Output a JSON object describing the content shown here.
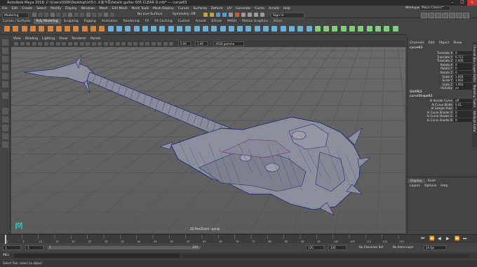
{
  "window": {
    "title": "Autodesk Maya 2018: C:\\Users\\SSW\\Desktop\\브라스 소울가족\\fatalis guitar 005 CLEAR D.mb*  ---  curve63"
  },
  "menubar": [
    "File",
    "Edit",
    "Create",
    "Select",
    "Modify",
    "Display",
    "Windows",
    "Mesh",
    "Edit Mesh",
    "Mesh Tools",
    "Mesh Display",
    "Curves",
    "Surfaces",
    "Deform",
    "UV",
    "Generate",
    "Cache",
    "Arnold",
    "Help"
  ],
  "workspace": {
    "label": "Workspace :",
    "value": "Maya Classic*"
  },
  "status": {
    "mode": "Modeling",
    "live_surface": "No Live Surface",
    "symmetry": "Symmetry: Off",
    "signin": "Sign In"
  },
  "shelf_tabs": [
    "Curves / Surfaces",
    "Poly Modeling",
    "Sculpting",
    "Rigging",
    "Animation",
    "Rendering",
    "FX",
    "FX Caching",
    "Custom",
    "Arnold",
    "Bifrost",
    "MASH",
    "Motion Graphics",
    "XGen"
  ],
  "shelf_active": "Poly Modeling",
  "panel_menu": [
    "View",
    "Shading",
    "Lighting",
    "Show",
    "Renderer",
    "Panels"
  ],
  "panel_toolbar": {
    "exposure": "0.00",
    "gamma": "1.00",
    "colorspace": "sRGB gamma"
  },
  "viewport": {
    "camera_label": "2D Pan/Zoom : persp",
    "axis_label": "y x z"
  },
  "channel_box": {
    "menu": [
      "Channels",
      "Edit",
      "Object",
      "Show"
    ],
    "object": "curve63",
    "attributes": [
      {
        "label": "Translate X",
        "value": "0"
      },
      {
        "label": "Translate Y",
        "value": "0.711"
      },
      {
        "label": "Translate Z",
        "value": "0.005"
      },
      {
        "label": "Rotate X",
        "value": "0"
      },
      {
        "label": "Rotate Y",
        "value": "0"
      },
      {
        "label": "Rotate Z",
        "value": "0"
      },
      {
        "label": "Scale X",
        "value": "1.003"
      },
      {
        "label": "Scale Y",
        "value": "1.003"
      },
      {
        "label": "Scale Z",
        "value": "1.003"
      },
      {
        "label": "Visibility",
        "value": "on"
      }
    ],
    "shapes_header": "SHAPES",
    "shape_name": "curveShape63",
    "shape_attributes": [
      {
        "label": "Ai Render Curve",
        "value": "off"
      },
      {
        "label": "Ai Curve Width",
        "value": "0.01"
      },
      {
        "label": "Ai Sample Rate",
        "value": "5"
      },
      {
        "label": "Ai Curve Shader R",
        "value": "0"
      },
      {
        "label": "Ai Curve Shader G",
        "value": "0"
      },
      {
        "label": "Ai Curve Shader B",
        "value": "0"
      }
    ]
  },
  "layers": {
    "tabs": [
      "Display",
      "Anim"
    ],
    "active_tab": "Display",
    "menu": [
      "Layers",
      "Options",
      "Help"
    ]
  },
  "side_tabs": [
    "Channel Box / Layer Editor",
    "Modeling Toolkit",
    "Attribute Editor"
  ],
  "time_slider": {
    "ticks": [
      "1",
      "5",
      "10",
      "15",
      "20",
      "25",
      "30",
      "35",
      "40",
      "45",
      "50",
      "55",
      "60",
      "65",
      "70",
      "75",
      "80",
      "85",
      "90",
      "95",
      "100",
      "105",
      "110",
      "115",
      "120"
    ],
    "current": "1"
  },
  "range_slider": {
    "start": "1",
    "inner_start": "1",
    "inner_end": "120",
    "end": "120",
    "max": "200",
    "character_set": "No Character Set",
    "anim_layer": "No Anim Layer",
    "fps": "24 fps"
  },
  "cmdline": {
    "label": "MEL"
  },
  "helpline": {
    "text": "Select Tool: select an object"
  }
}
